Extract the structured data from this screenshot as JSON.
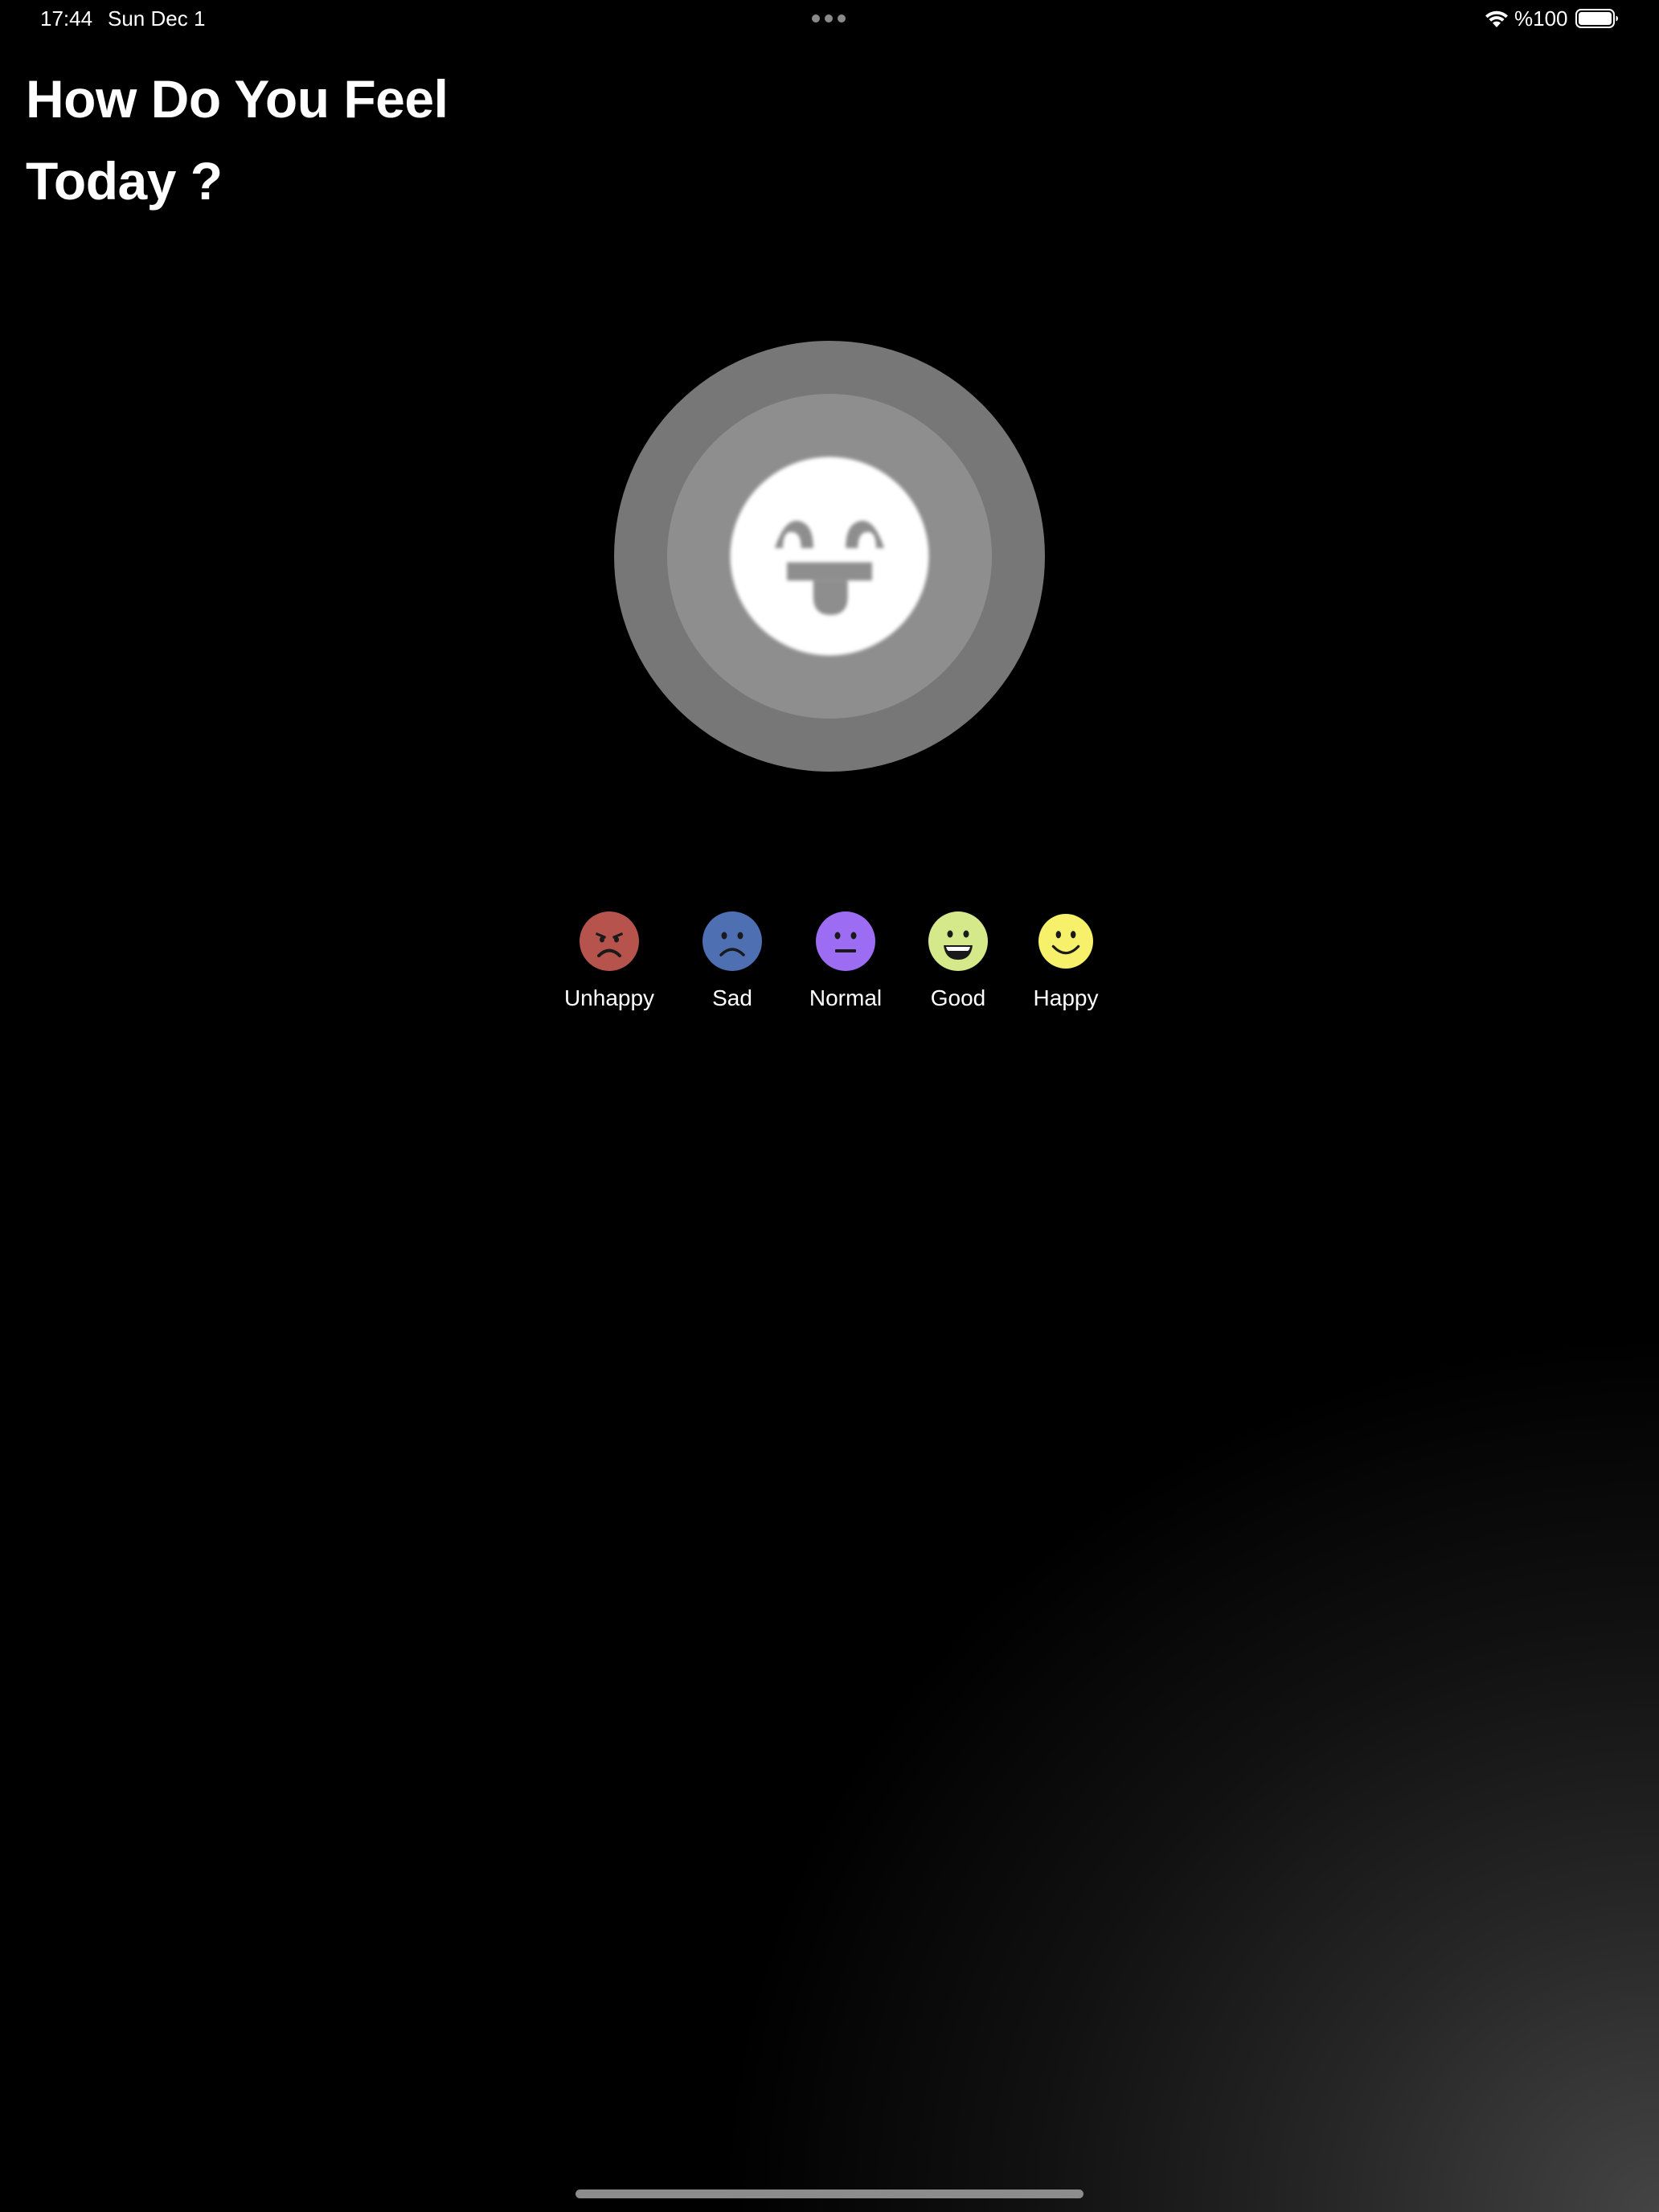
{
  "status_bar": {
    "time": "17:44",
    "date": "Sun Dec 1",
    "battery": "%100",
    "wifi_icon": "wifi-icon",
    "battery_icon": "battery-icon",
    "multitask_icon": "ellipsis-icon"
  },
  "title": {
    "line1": "How Do You Feel",
    "line2": "Today ?"
  },
  "selected_mood": {
    "icon": "tongue-out-face-icon",
    "colors": {
      "outer": "#777777",
      "inner": "#8e8e8e",
      "face": "#ffffff"
    }
  },
  "moods": [
    {
      "label": "Unhappy",
      "icon": "angry-face-icon",
      "color": "#b5534c"
    },
    {
      "label": "Sad",
      "icon": "sad-face-icon",
      "color": "#4f6fb3"
    },
    {
      "label": "Normal",
      "icon": "neutral-face-icon",
      "color": "#9c6cf2"
    },
    {
      "label": "Good",
      "icon": "grinning-face-icon",
      "color": "#d6e98a"
    },
    {
      "label": "Happy",
      "icon": "smiling-face-icon",
      "color": "#f7f06a"
    }
  ]
}
